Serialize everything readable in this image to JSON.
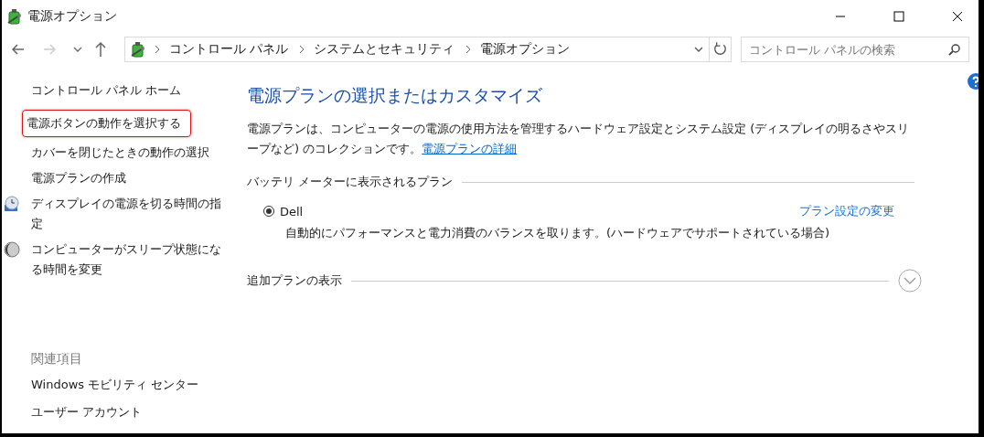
{
  "window": {
    "title": "電源オプション"
  },
  "address_bar": {
    "crumbs": [
      "コントロール パネル",
      "システムとセキュリティ",
      "電源オプション"
    ]
  },
  "search": {
    "placeholder": "コントロール パネルの検索"
  },
  "sidebar": {
    "items": [
      {
        "label": "コントロール パネル ホーム",
        "kind": "text",
        "highlighted": false
      },
      {
        "label": "電源ボタンの動作を選択する",
        "kind": "text",
        "highlighted": true
      },
      {
        "label": "カバーを閉じたときの動作の選択",
        "kind": "text",
        "highlighted": false
      },
      {
        "label": "電源プランの作成",
        "kind": "text",
        "highlighted": false
      },
      {
        "label": "ディスプレイの電源を切る時間の指定",
        "kind": "display",
        "highlighted": false
      },
      {
        "label": "コンピューターがスリープ状態になる時間を変更",
        "kind": "sleep",
        "highlighted": false
      }
    ],
    "related_heading": "関連項目",
    "related": [
      "Windows モビリティ センター",
      "ユーザー アカウント"
    ]
  },
  "main": {
    "heading": "電源プランの選択またはカスタマイズ",
    "description": "電源プランは、コンピューターの電源の使用方法を管理するハードウェア設定とシステム設定 (ディスプレイの明るさやスリープなど) のコレクションです。",
    "description_link": "電源プランの詳細",
    "section": "バッテリ メーターに表示されるプラン",
    "plans": [
      {
        "name": "Dell",
        "selected": true,
        "description": "自動的にパフォーマンスと電力消費のバランスを取ります。(ハードウェアでサポートされている場合)",
        "link": "プラン設定の変更"
      }
    ],
    "more_plans": {
      "label": "追加プランの表示",
      "expanded": false
    }
  }
}
